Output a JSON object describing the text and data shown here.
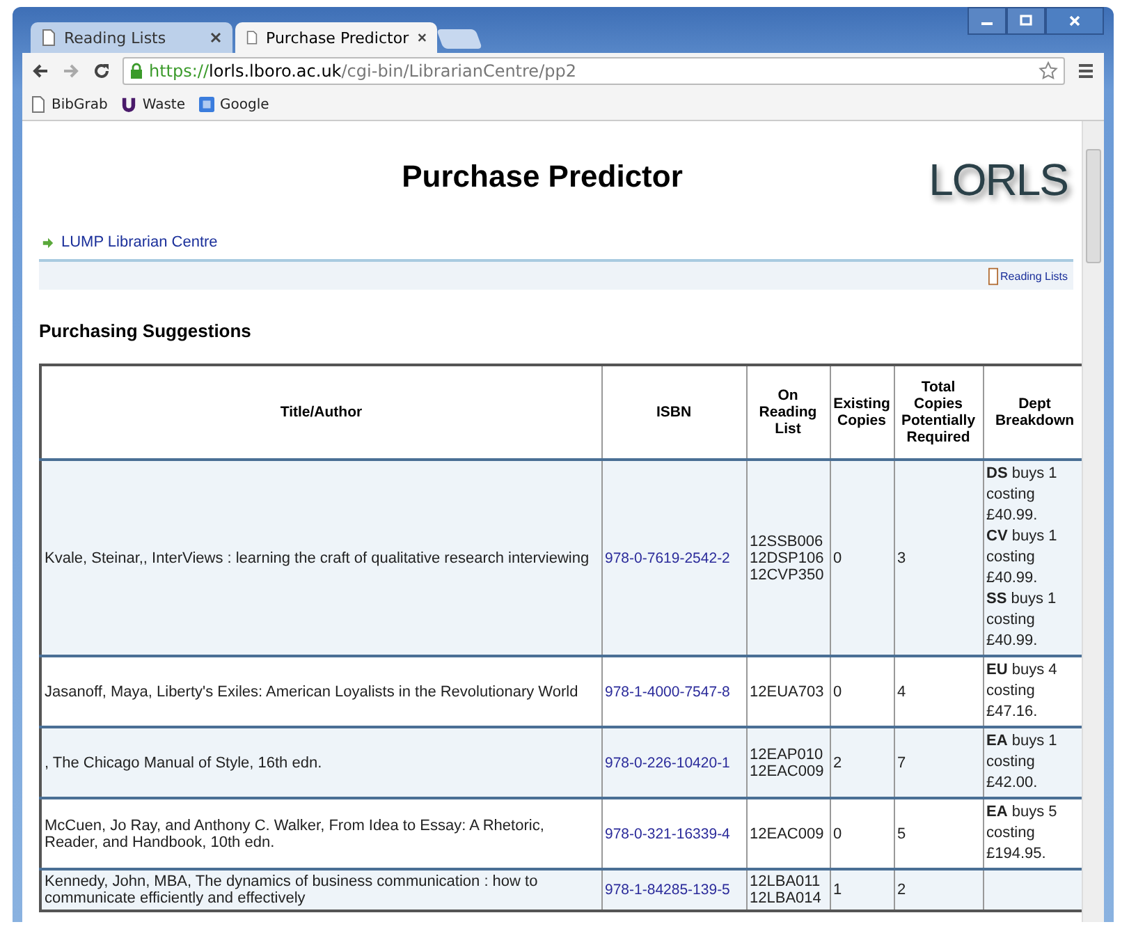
{
  "browser": {
    "tabs": [
      {
        "label": "Reading Lists",
        "selected": false
      },
      {
        "label": "Purchase Predictor",
        "selected": true
      }
    ],
    "url": {
      "scheme": "https://",
      "host": "lorls.lboro.ac.uk",
      "path": "/cgi-bin/LibrarianCentre/pp2"
    },
    "bookmarks": [
      {
        "label": "BibGrab",
        "kind": "page"
      },
      {
        "label": "Waste",
        "kind": "u"
      },
      {
        "label": "Google",
        "kind": "g"
      }
    ]
  },
  "page": {
    "title": "Purchase Predictor",
    "logo": "LORLS",
    "nav_link": "LUMP Librarian Centre",
    "reading_lists_link": "Reading Lists",
    "section_title": "Purchasing Suggestions",
    "table": {
      "columns": [
        "Title/Author",
        "ISBN",
        "On Reading List",
        "Existing Copies",
        "Total Copies Potentially Required",
        "Dept Breakdown"
      ],
      "rows": [
        {
          "title": "Kvale, Steinar,, InterViews : learning the craft of qualitative research interviewing",
          "isbn": "978-0-7619-2542-2",
          "lists": [
            "12SSB006",
            "12DSP106",
            "12CVP350"
          ],
          "existing": "0",
          "total": "3",
          "breakdown": [
            "**DS** buys 1 costing £40.99.",
            "**CV** buys 1 costing £40.99.",
            "**SS** buys 1 costing £40.99."
          ]
        },
        {
          "title": "Jasanoff, Maya, Liberty's Exiles: American Loyalists in the Revolutionary World",
          "isbn": "978-1-4000-7547-8",
          "lists": [
            "12EUA703"
          ],
          "existing": "0",
          "total": "4",
          "breakdown": [
            "**EU** buys 4 costing £47.16."
          ]
        },
        {
          "title": ", The Chicago Manual of Style, 16th edn.",
          "isbn": "978-0-226-10420-1",
          "lists": [
            "12EAP010",
            "12EAC009"
          ],
          "existing": "2",
          "total": "7",
          "breakdown": [
            "**EA** buys 1 costing £42.00."
          ]
        },
        {
          "title": "McCuen, Jo Ray, and Anthony C. Walker, From Idea to Essay: A Rhetoric, Reader, and Handbook, 10th edn.",
          "isbn": "978-0-321-16339-4",
          "lists": [
            "12EAC009"
          ],
          "existing": "0",
          "total": "5",
          "breakdown": [
            "**EA** buys 5 costing £194.95."
          ]
        },
        {
          "title": "Kennedy, John, MBA, The dynamics of business communication : how to communicate efficiently and effectively",
          "isbn": "978-1-84285-139-5",
          "lists": [
            "12LBA011",
            "12LBA014"
          ],
          "existing": "1",
          "total": "2",
          "breakdown": []
        }
      ]
    }
  }
}
